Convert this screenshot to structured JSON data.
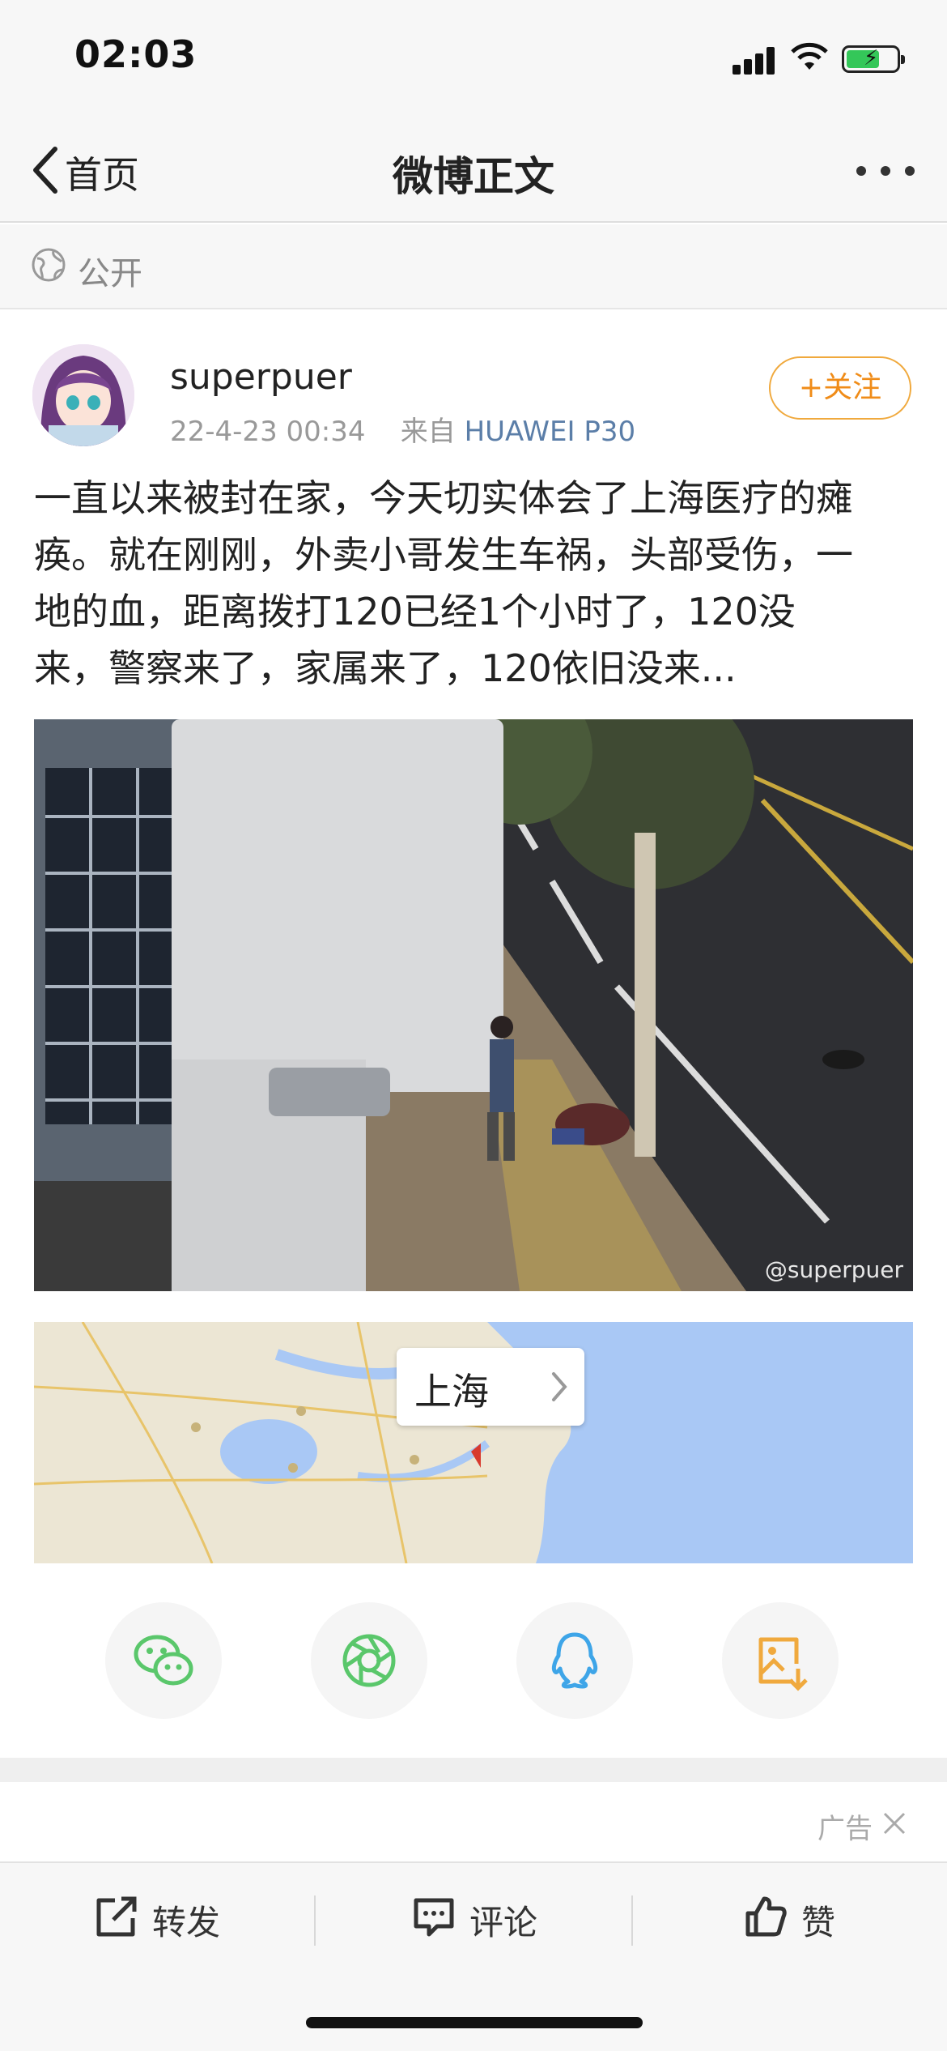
{
  "status_bar": {
    "time": "02:03",
    "battery_color": "#34c759"
  },
  "nav": {
    "back_label": "首页",
    "title": "微博正文"
  },
  "privacy": {
    "label": "公开",
    "icon": "globe-icon"
  },
  "post": {
    "username": "superpuer",
    "date": "22-4-23 00:34",
    "source_prefix": "来自",
    "source": "HUAWEI P30",
    "follow_label": "+关注",
    "text_lines": [
      "一直以来被封在家，今天切实体会了上海医疗的瘫",
      "痪。就在刚刚，外卖小哥发生车祸，头部受伤，一",
      "地的血，距离拨打120已经1个小时了，120没",
      "来，警察来了，家属来了，120依旧没来..."
    ],
    "image_watermark": "@superpuer",
    "location": "上海"
  },
  "share": [
    {
      "name": "wechat-icon",
      "color": "#5ac76b"
    },
    {
      "name": "moments-icon",
      "color": "#5ac76b"
    },
    {
      "name": "qq-icon",
      "color": "#3ea5e8"
    },
    {
      "name": "save-image-icon",
      "color": "#f0a93d"
    }
  ],
  "ad": {
    "label": "广告"
  },
  "actions": {
    "repost": "转发",
    "comment": "评论",
    "like": "赞"
  },
  "accent_color": "#f08c18"
}
